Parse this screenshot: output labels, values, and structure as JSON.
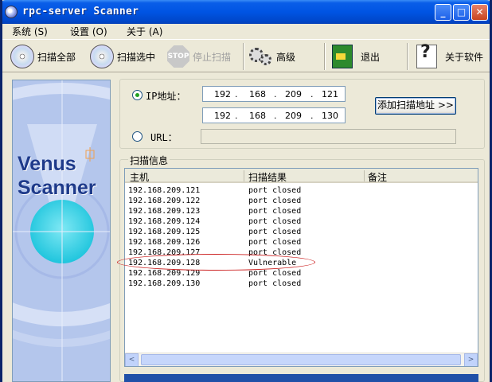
{
  "window": {
    "title": "rpc-server Scanner",
    "minimize_glyph": "_",
    "maximize_glyph": "□",
    "close_glyph": "✕"
  },
  "menu": [
    {
      "label": "系统 (S)"
    },
    {
      "label": "设置 (O)"
    },
    {
      "label": "关于 (A)"
    }
  ],
  "toolbar": {
    "scan_all": "扫描全部",
    "scan_selected": "扫描选中",
    "stop_icon_text": "STOP",
    "stop_scan": "停止扫描",
    "advanced": "高级",
    "exit": "退出",
    "about": "关于软件"
  },
  "sidebar": {
    "logo_line1": "Venus",
    "logo_line2": "Scanner"
  },
  "ip": {
    "ip_radio_label": "IP地址：",
    "url_radio_label": "URL：",
    "start": [
      "192",
      "168",
      "209",
      "121"
    ],
    "end": [
      "192",
      "168",
      "209",
      "130"
    ],
    "dot": ".",
    "add_button": "添加扫描地址 >>",
    "url_value": ""
  },
  "results": {
    "group_label": "扫描信息",
    "columns": [
      "主机",
      "扫描结果",
      "备注"
    ],
    "rows": [
      {
        "host": "192.168.209.121",
        "result": "port closed",
        "note": ""
      },
      {
        "host": "192.168.209.122",
        "result": "port closed",
        "note": ""
      },
      {
        "host": "192.168.209.123",
        "result": "port closed",
        "note": ""
      },
      {
        "host": "192.168.209.124",
        "result": "port closed",
        "note": ""
      },
      {
        "host": "192.168.209.125",
        "result": "port closed",
        "note": ""
      },
      {
        "host": "192.168.209.126",
        "result": "port closed",
        "note": ""
      },
      {
        "host": "192.168.209.127",
        "result": "port closed",
        "note": ""
      },
      {
        "host": "192.168.209.128",
        "result": "Vulnerable",
        "note": ""
      },
      {
        "host": "192.168.209.129",
        "result": "port closed",
        "note": ""
      },
      {
        "host": "192.168.209.130",
        "result": "port closed",
        "note": ""
      }
    ],
    "scroll_left": "<",
    "scroll_right": ">"
  },
  "colors": {
    "highlight_ellipse": "#cc2222",
    "titlebar": "#0054e3"
  }
}
